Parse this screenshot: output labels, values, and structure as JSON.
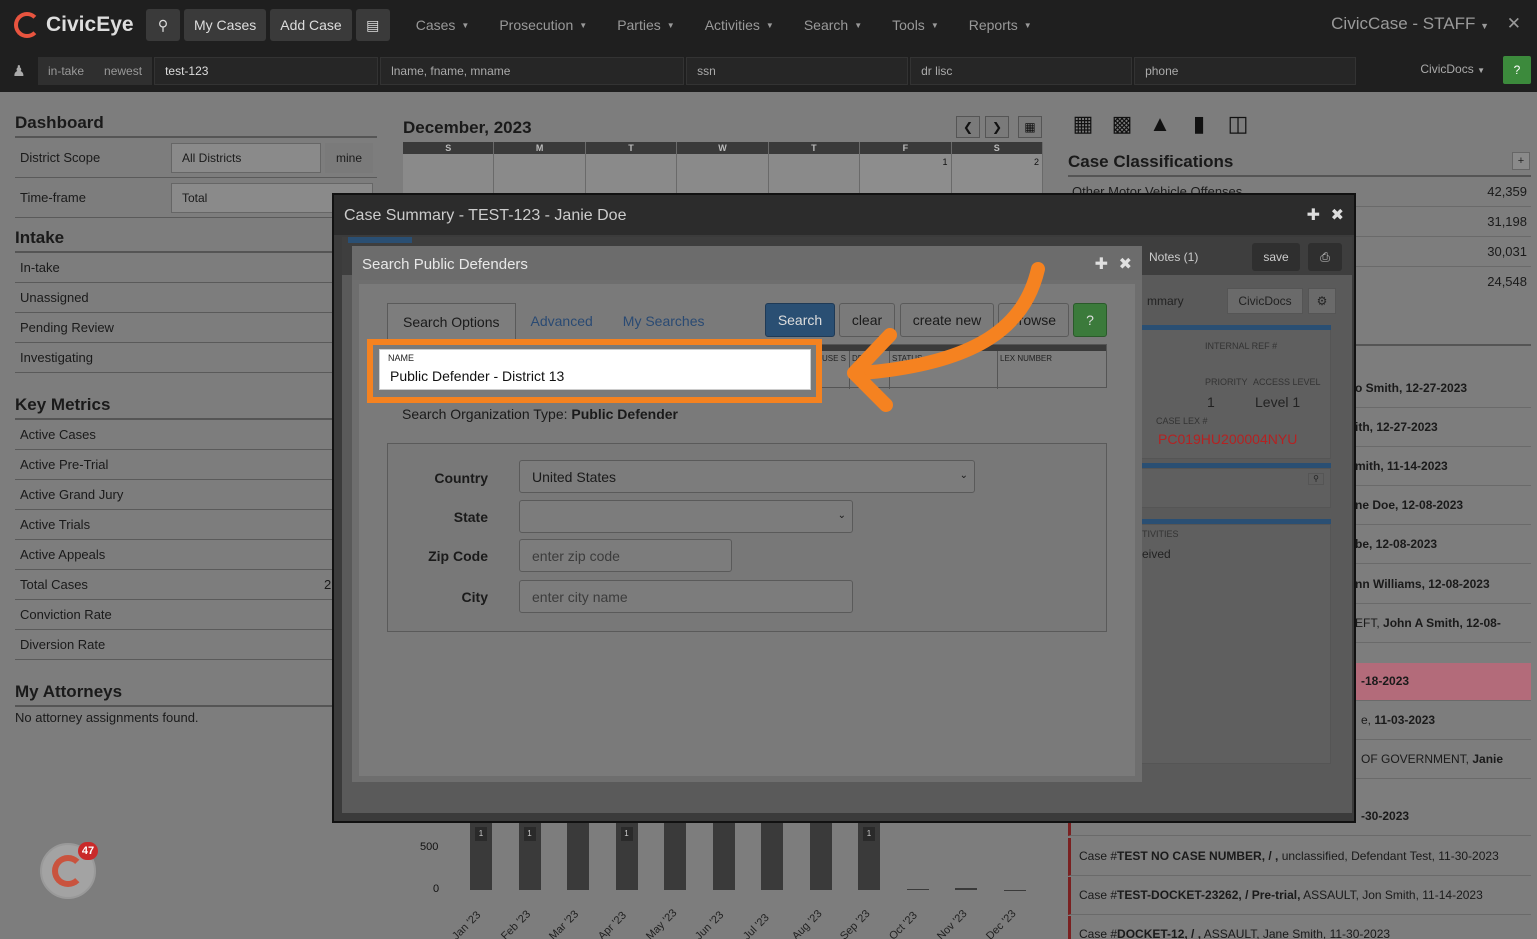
{
  "topnav": {
    "brand": "CivicEye",
    "my_cases": "My Cases",
    "add_case": "Add Case",
    "menus": [
      "Cases",
      "Prosecution",
      "Parties",
      "Activities",
      "Search",
      "Tools",
      "Reports"
    ],
    "app_title": "CivicCase - STAFF",
    "close": "✕"
  },
  "subbar": {
    "intake": "in-take",
    "newest": "newest",
    "case_search_value": "test-123",
    "name_placeholder": "lname, fname, mname",
    "ssn_placeholder": "ssn",
    "drlisc_placeholder": "dr lisc",
    "phone_placeholder": "phone",
    "civicdocs": "CivicDocs",
    "help": "?"
  },
  "dashboard": {
    "title": "Dashboard",
    "district_scope_label": "District Scope",
    "district_scope_value": "All Districts",
    "mine": "mine",
    "timeframe_label": "Time-frame",
    "timeframe_value": "Total",
    "intake_title": "Intake",
    "intake_items": [
      "In-take",
      "Unassigned",
      "Pending Review",
      "Investigating"
    ],
    "metrics_title": "Key Metrics",
    "metrics_items": [
      "Active Cases",
      "Active Pre-Trial",
      "Active Grand Jury",
      "Active Trials",
      "Active Appeals",
      "Total Cases",
      "Conviction Rate",
      "Diversion Rate"
    ],
    "total_cases_partial": "2",
    "attorneys_title": "My Attorneys",
    "attorneys_empty": "No attorney assignments found."
  },
  "calendar": {
    "title": "December, 2023",
    "days": [
      "S",
      "M",
      "T",
      "W",
      "T",
      "F",
      "S"
    ],
    "dates": [
      "",
      "",
      "",
      "",
      "",
      "1",
      "2"
    ]
  },
  "case_classifications": {
    "title": "Case Classifications",
    "plus": "+",
    "first_label": "Other Motor Vehicle Offenses",
    "counts": [
      "42,359",
      "31,198",
      "30,031",
      "24,548"
    ]
  },
  "activities": [
    {
      "prefix": "",
      "bold": "o Smith, 12-27-2023",
      "rest": ""
    },
    {
      "prefix": "",
      "bold": "ith, 12-27-2023",
      "rest": ""
    },
    {
      "prefix": "",
      "bold": "mith, 11-14-2023",
      "rest": ""
    },
    {
      "prefix": "",
      "bold": "ne Doe, 12-08-2023",
      "rest": ""
    },
    {
      "prefix": "",
      "bold": "be, 12-08-2023",
      "rest": ""
    },
    {
      "prefix": "",
      "bold": "nn Williams, 12-08-2023",
      "rest": ""
    },
    {
      "prefix": "EFT, ",
      "bold": "John A Smith, 12-08-",
      "rest": ""
    },
    {
      "prefix": "",
      "bold": "-18-2023",
      "rest": ""
    },
    {
      "prefix": "e, ",
      "bold": "11-03-2023",
      "rest": ""
    },
    {
      "prefix": "OF GOVERNMENT, ",
      "bold": "Janie",
      "rest": ""
    },
    {
      "prefix": "",
      "bold": "-30-2023",
      "rest": ""
    },
    {
      "prefix": "Case #",
      "bold": "TEST NO CASE NUMBER, / ,",
      "rest": " unclassified, Defendant Test, 11-30-2023"
    },
    {
      "prefix": "Case #",
      "bold": "TEST-DOCKET-23262, / Pre-trial,",
      "rest": " ASSAULT, Jon Smith, 11-14-2023"
    },
    {
      "prefix": "Case #",
      "bold": "DOCKET-12, / ,",
      "rest": " ASSAULT, Jane Smith, 11-30-2023"
    }
  ],
  "chart_data": {
    "type": "bar",
    "categories": [
      "Jan '23",
      "Feb '23",
      "Mar '23",
      "Apr '23",
      "May '23",
      "Jun '23",
      "Jul '23",
      "Aug '23",
      "Sep '23",
      "Oct '23",
      "Nov '23",
      "Dec '23"
    ],
    "values": [
      null,
      null,
      null,
      null,
      null,
      null,
      null,
      null,
      null,
      15,
      20,
      0
    ],
    "yticks": [
      "500",
      "0"
    ],
    "bar_labels": [
      "1",
      "1",
      "",
      "1",
      "",
      "",
      "",
      "",
      "1",
      "",
      "",
      ""
    ]
  },
  "case_summary": {
    "title": "Case Summary - TEST-123 - Janie Doe",
    "notes": "Notes (1)",
    "save": "save",
    "summary_partial": "mmary",
    "civicdocs": "CivicDocs",
    "internal_ref_label": "INTERNAL REF #",
    "priority_label": "PRIORITY",
    "priority_value": "1",
    "access_label": "ACCESS LEVEL",
    "access_value": "Level 1",
    "case_lex_label": "CASE LEX #",
    "case_lex_value": "PC019HU200004NYU",
    "activities_label": "TIVITIES",
    "received_partial": "eived"
  },
  "search_modal": {
    "title": "Search Public Defenders",
    "tabs": [
      "Search Options",
      "Advanced",
      "My Searches"
    ],
    "search": "Search",
    "clear": "clear",
    "create_new": "create new",
    "browse": "browse",
    "help": "?",
    "grid_headers": [
      "USE S",
      "DEX",
      "STATUS",
      "LEX NUMBER"
    ],
    "name_label": "NAME",
    "name_value": "Public Defender - District 13",
    "org_type_label": "Search Organization Type:",
    "org_type_value": "Public Defender",
    "country_label": "Country",
    "country_value": "United States",
    "state_label": "State",
    "state_value": "",
    "zip_label": "Zip Code",
    "zip_placeholder": "enter zip code",
    "city_label": "City",
    "city_placeholder": "enter city name"
  },
  "colors": {
    "highlight": "#f58220",
    "brand_red": "#e8543f",
    "primary_blue": "#2a4f73",
    "help_green": "#3c8a3c"
  }
}
